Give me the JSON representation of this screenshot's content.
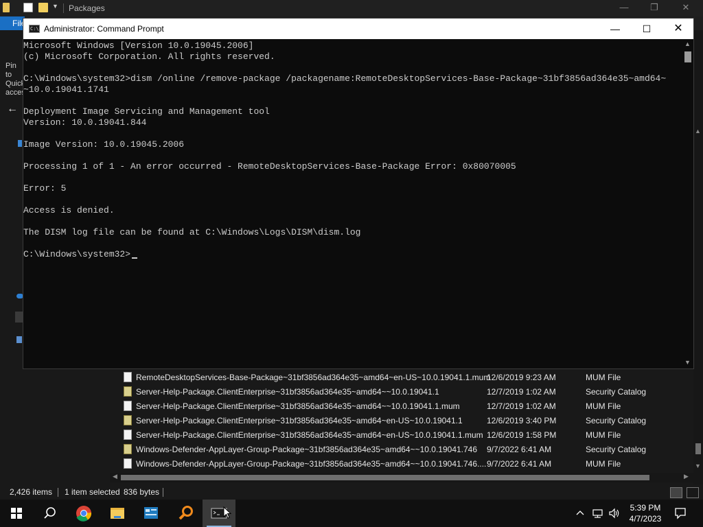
{
  "explorer": {
    "title": "Packages",
    "file_tab": "File",
    "pin_text": "Pin to Quick access",
    "files": [
      {
        "name": "RemoteDesktopServices-Base-Package~31bf3856ad364e35~amd64~en-US~10.0.19041.1.mum",
        "date": "12/6/2019 9:23 AM",
        "type": "MUM File",
        "icon": "file-icon"
      },
      {
        "name": "Server-Help-Package.ClientEnterprise~31bf3856ad364e35~amd64~~10.0.19041.1",
        "date": "12/7/2019 1:02 AM",
        "type": "Security Catalog",
        "icon": "catalog-icon"
      },
      {
        "name": "Server-Help-Package.ClientEnterprise~31bf3856ad364e35~amd64~~10.0.19041.1.mum",
        "date": "12/7/2019 1:02 AM",
        "type": "MUM File",
        "icon": "file-icon"
      },
      {
        "name": "Server-Help-Package.ClientEnterprise~31bf3856ad364e35~amd64~en-US~10.0.19041.1",
        "date": "12/6/2019 3:40 PM",
        "type": "Security Catalog",
        "icon": "catalog-icon"
      },
      {
        "name": "Server-Help-Package.ClientEnterprise~31bf3856ad364e35~amd64~en-US~10.0.19041.1.mum",
        "date": "12/6/2019 1:58 PM",
        "type": "MUM File",
        "icon": "file-icon"
      },
      {
        "name": "Windows-Defender-AppLayer-Group-Package~31bf3856ad364e35~amd64~~10.0.19041.746",
        "date": "9/7/2022 6:41 AM",
        "type": "Security Catalog",
        "icon": "catalog-icon"
      },
      {
        "name": "Windows-Defender-AppLayer-Group-Package~31bf3856ad364e35~amd64~~10.0.19041.746....",
        "date": "9/7/2022 6:41 AM",
        "type": "MUM File",
        "icon": "file-icon"
      }
    ],
    "status": {
      "item_count": "2,426 items",
      "selection": "1 item selected",
      "size": "836 bytes"
    }
  },
  "cmd": {
    "title": "Administrator: Command Prompt",
    "icon_text": "C:\\",
    "lines": [
      "Microsoft Windows [Version 10.0.19045.2006]",
      "(c) Microsoft Corporation. All rights reserved.",
      "",
      "C:\\Windows\\system32>dism /online /remove-package /packagename:RemoteDesktopServices-Base-Package~31bf3856ad364e35~amd64~",
      "~10.0.19041.1741",
      "",
      "Deployment Image Servicing and Management tool",
      "Version: 10.0.19041.844",
      "",
      "Image Version: 10.0.19045.2006",
      "",
      "Processing 1 of 1 - An error occurred - RemoteDesktopServices-Base-Package Error: 0x80070005",
      "",
      "Error: 5",
      "",
      "Access is denied.",
      "",
      "The DISM log file can be found at C:\\Windows\\Logs\\DISM\\dism.log",
      "",
      "C:\\Windows\\system32>"
    ]
  },
  "taskbar": {
    "time": "5:39 PM",
    "date": "4/7/2023",
    "apps": [
      "start-icon",
      "search-icon",
      "chrome-icon",
      "file-explorer-icon",
      "control-panel-icon",
      "search-app-icon",
      "command-prompt-icon"
    ]
  },
  "colors": {
    "accent": "#1a6fc4",
    "console_bg": "#0c0c0c",
    "console_text": "#cccccc",
    "taskbar_bg": "#101010"
  }
}
